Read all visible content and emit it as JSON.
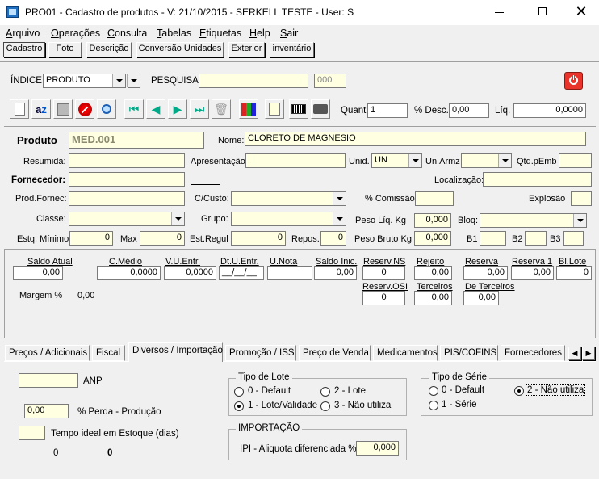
{
  "window": {
    "title": "PRO01 - Cadastro de produtos - V: 21/10/2015 - SERKELL TESTE - User: S"
  },
  "menu": [
    "Arquivo",
    "Operações",
    "Consulta",
    "Tabelas",
    "Etiquetas",
    "Help",
    "Sair"
  ],
  "top_tabs": [
    "Cadastro",
    "Foto",
    "Descrição",
    "Conversão Unidades",
    "Exterior",
    "inventário"
  ],
  "search": {
    "indice_label": "ÍNDICE",
    "indice_value": "PRODUTO",
    "pesquisa_label": "PESQUISA",
    "pesquisa_value": "",
    "code": "000"
  },
  "toolbar": {
    "quant_label": "Quant",
    "quant_value": "1",
    "desc_label": "% Desc.",
    "desc_value": "0,00",
    "liq_label": "Líq.",
    "liq_value": "0,0000"
  },
  "produto": {
    "produto_label": "Produto",
    "produto_value": "MED.001",
    "nome_label": "Nome:",
    "nome_value": "CLORETO DE MAGNESIO",
    "resumida_label": "Resumida:",
    "apresentacao_label": "Apresentação:",
    "unid_label": "Unid.",
    "unid_value": "UN",
    "unarmz_label": "Un.Armz",
    "qtdpemb_label": "Qtd.pEmb",
    "fornecedor_label": "Fornecedor:",
    "localizacao_label": "Localização:",
    "prodfornec_label": "Prod.Fornec:",
    "ccusto_label": "C/Custo:",
    "comissao_label": "% Comissão:",
    "explosao_label": "Explosão",
    "classe_label": "Classe:",
    "grupo_label": "Grupo:",
    "pesoliq_label": "Peso Líq. Kg",
    "pesoliq_value": "0,000",
    "bloq_label": "Bloq:",
    "estqmin_label": "Estq. Mínimo",
    "estqmin_value": "0",
    "max_label": "Max",
    "max_value": "0",
    "estregul_label": "Est.Regul",
    "estregul_value": "0",
    "repos_label": "Repos.",
    "repos_value": "0",
    "pesobruto_label": "Peso Bruto Kg",
    "pesobruto_value": "0,000",
    "b1_label": "B1",
    "b2_label": "B2",
    "b3_label": "B3"
  },
  "saldos": {
    "saldo_atual_label": "Saldo Atual",
    "saldo_atual": "0,00",
    "cmedio_label": "C.Médio",
    "cmedio": "0,0000",
    "vuentr_label": "V.U.Entr.",
    "vuentr": "0,0000",
    "dtuentr_label": "Dt.U.Entr.",
    "dtuentr": "__/__/__",
    "unota_label": "U.Nota",
    "unota": "",
    "saldoinic_label": "Saldo Inic.",
    "saldoinic": "0,00",
    "reservns_label": "Reserv.NS",
    "reservns": "0",
    "rejeito_label": "Rejeito",
    "rejeito": "0,00",
    "reserva_label": "Reserva",
    "reserva": "0,00",
    "reserva1_label": "Reserva 1",
    "reserva1": "0,00",
    "bllote_label": "Bl.Lote",
    "bllote": "0",
    "margem_label": "Margem  %",
    "margem_value": "0,00",
    "reservosi_label": "Reserv.OSI",
    "reservosi": "0",
    "terceiros_label": "Terceiros",
    "terceiros": "0,00",
    "deterceiros_label": "De Terceiros",
    "deterceiros": "0,00"
  },
  "bottom_tabs": [
    "Preços / Adicionais",
    "Fiscal",
    "Diversos / Importação",
    "Promoção / ISS",
    "Preço de Venda",
    "Medicamentos",
    "PIS/COFINS",
    "Fornecedores"
  ],
  "diversos": {
    "anp_label": "ANP",
    "anp_value": "",
    "perda_label": "% Perda - Produção",
    "perda_value": "0,00",
    "tempo_label": "Tempo ideal em Estoque (dias)",
    "tempo_value": "",
    "count_a": "0",
    "count_b": "0"
  },
  "tipo_lote": {
    "title": "Tipo de Lote",
    "opt0": "0 - Default",
    "opt1": "1 - Lote/Validade",
    "opt2": "2 - Lote",
    "opt3": "3 - Não utiliza"
  },
  "tipo_serie": {
    "title": "Tipo de Série",
    "opt0": "0 - Default",
    "opt1": "1 - Série",
    "opt2": "2 - Não utiliza"
  },
  "importacao": {
    "title": "IMPORTAÇÃO",
    "ipi_label": "IPI - Aliquota diferenciada %",
    "ipi_value": "0,000"
  }
}
